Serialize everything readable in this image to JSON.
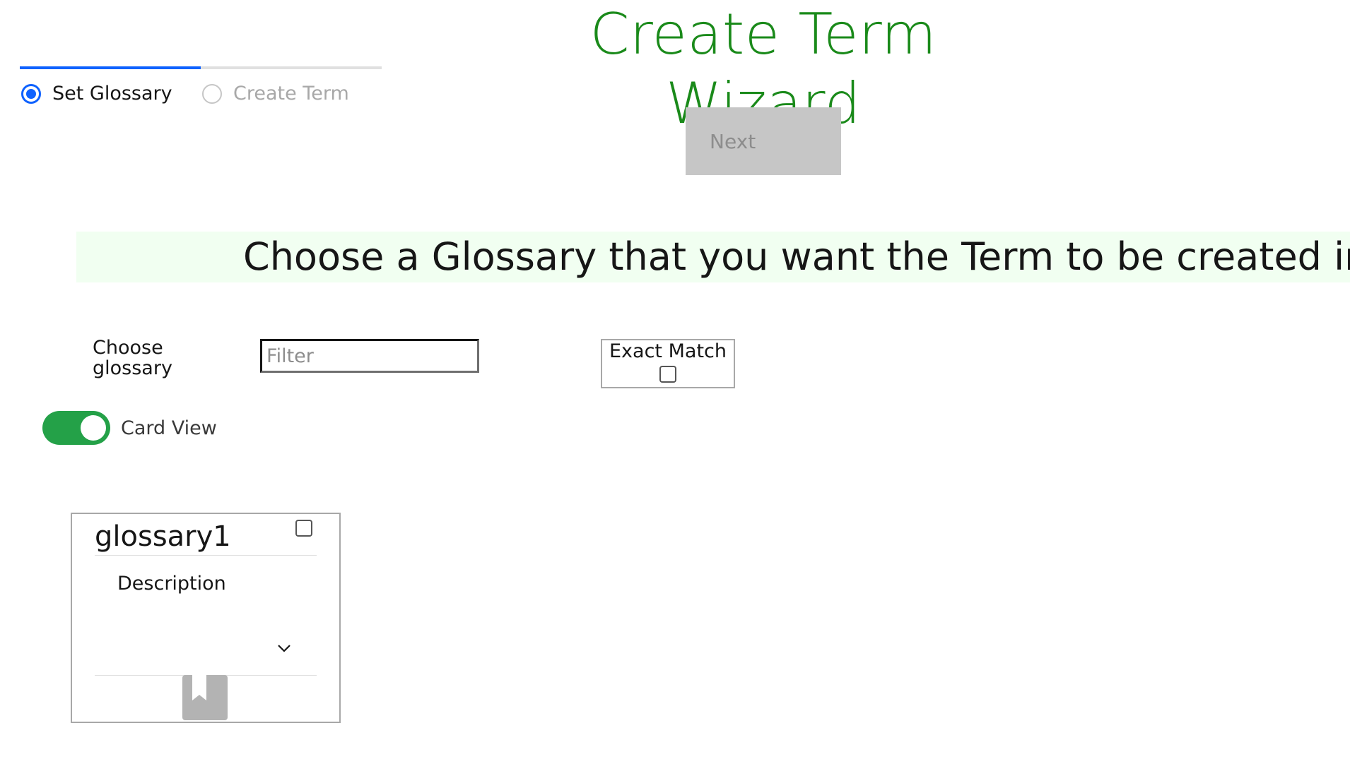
{
  "wizard": {
    "title": "Create Term Wizard"
  },
  "progress": {
    "steps": [
      {
        "label": "Set Glossary",
        "state": "current"
      },
      {
        "label": "Create Term",
        "state": "incomplete"
      }
    ]
  },
  "actions": {
    "next_label": "Next"
  },
  "instruction": "Choose a Glossary that you want the Term to be created in.",
  "filter": {
    "label": "Choose glossary",
    "placeholder": "Filter",
    "value": "",
    "exact_match_label": "Exact Match",
    "exact_match_checked": false
  },
  "view_toggle": {
    "label": "Card View",
    "on": true
  },
  "glossaries": [
    {
      "name": "glossary1",
      "description_label": "Description",
      "selected": false,
      "icon": "bookmark-icon"
    }
  ],
  "colors": {
    "title": "#1a8a1a",
    "progress_active": "#0f62fe",
    "toggle_on": "#24a148",
    "banner_bg": "#f1fff1",
    "next_disabled_bg": "#c6c6c6"
  }
}
